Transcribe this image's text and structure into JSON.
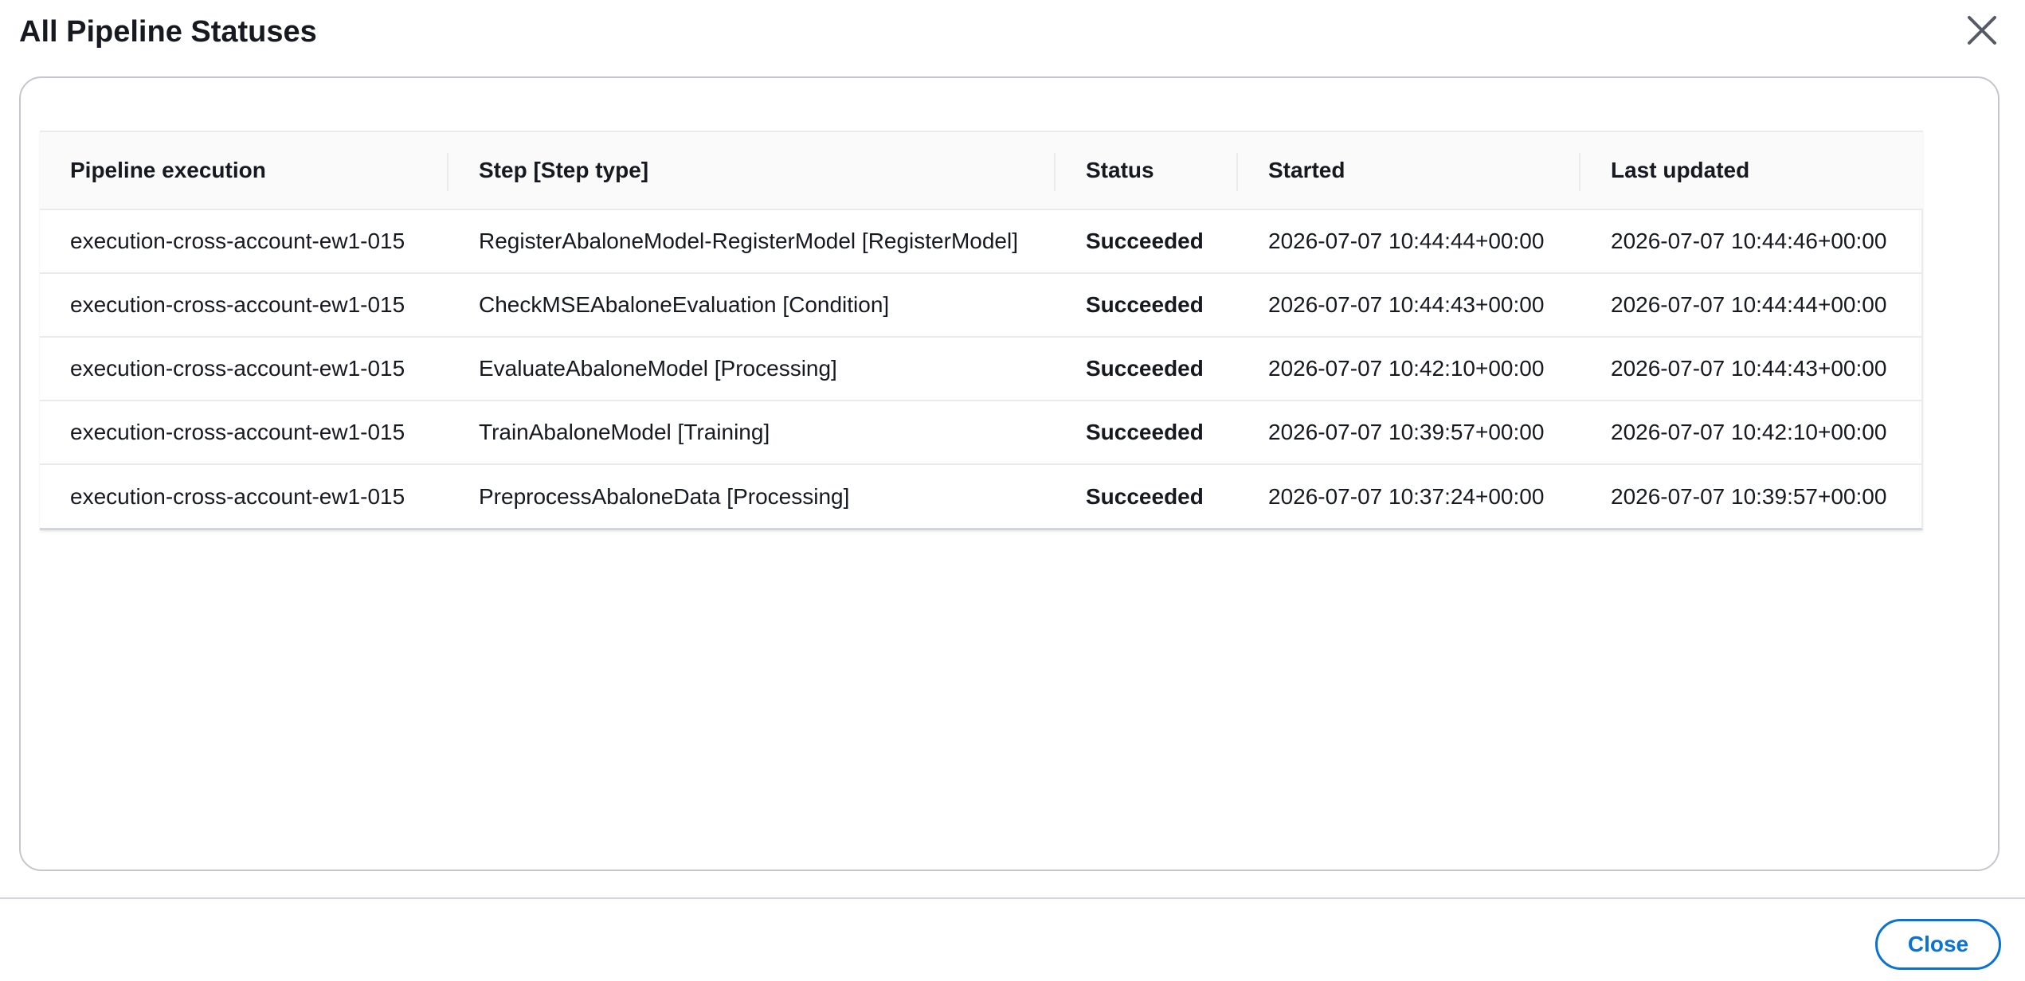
{
  "modal": {
    "title": "All Pipeline Statuses",
    "close_icon": "close-x-icon"
  },
  "table": {
    "columns": [
      "Pipeline execution",
      "Step [Step type]",
      "Status",
      "Started",
      "Last updated"
    ],
    "rows": [
      [
        "execution-cross-account-ew1-015",
        "RegisterAbaloneModel-RegisterModel [RegisterModel]",
        "Succeeded",
        "2026-07-07 10:44:44+00:00",
        "2026-07-07 10:44:46+00:00"
      ],
      [
        "execution-cross-account-ew1-015",
        "CheckMSEAbaloneEvaluation [Condition]",
        "Succeeded",
        "2026-07-07 10:44:43+00:00",
        "2026-07-07 10:44:44+00:00"
      ],
      [
        "execution-cross-account-ew1-015",
        "EvaluateAbaloneModel [Processing]",
        "Succeeded",
        "2026-07-07 10:42:10+00:00",
        "2026-07-07 10:44:43+00:00"
      ],
      [
        "execution-cross-account-ew1-015",
        "TrainAbaloneModel [Training]",
        "Succeeded",
        "2026-07-07 10:39:57+00:00",
        "2026-07-07 10:42:10+00:00"
      ],
      [
        "execution-cross-account-ew1-015",
        "PreprocessAbaloneData [Processing]",
        "Succeeded",
        "2026-07-07 10:37:24+00:00",
        "2026-07-07 10:39:57+00:00"
      ]
    ]
  },
  "footer": {
    "close_label": "Close"
  },
  "colors": {
    "primary_blue": "#0972d3",
    "text": "#16191f",
    "border": "#c6c6cd"
  }
}
